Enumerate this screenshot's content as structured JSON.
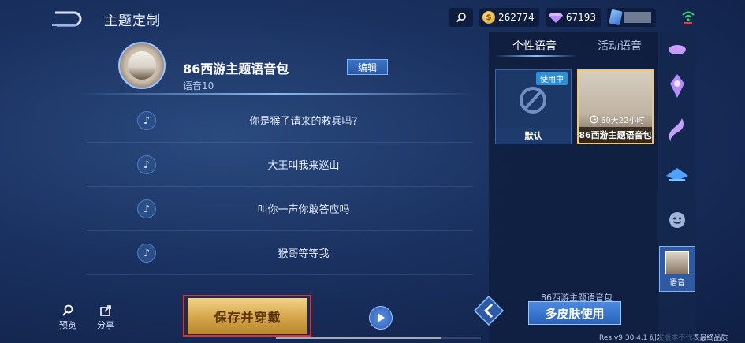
{
  "header": {
    "title": "主题定制"
  },
  "topbar": {
    "gold": "262774",
    "gems": "67193"
  },
  "profile": {
    "pack_name": "86西游主题语音包",
    "subtitle": "语音10",
    "edit_label": "编辑"
  },
  "voice_lines": [
    "你是猴子请来的救兵吗?",
    "大王叫我来巡山",
    "叫你一声你敢答应吗",
    "猴哥等等我"
  ],
  "bottom_tools": {
    "preview": "预览",
    "share": "分享"
  },
  "save_button": "保存并穿戴",
  "right_panel": {
    "tabs": [
      "个性语音",
      "活动语音"
    ],
    "active_tab": 0,
    "cards": [
      {
        "label": "默认",
        "badge": "使用中"
      },
      {
        "label": "86西游主题语音包",
        "timer": "60天22小时"
      }
    ],
    "selected_name": "86西游主题语音包",
    "multi_skin_button": "多皮肤使用"
  },
  "categories": {
    "active_label": "语音"
  },
  "version": "Res v9.30.4.1 研发版本不代表最终品质",
  "colors": {
    "accent": "#4b8ae0",
    "gold_button": "#d7a84d",
    "highlight_border": "#e5302a",
    "in_use_badge": "#2f8fd6"
  }
}
